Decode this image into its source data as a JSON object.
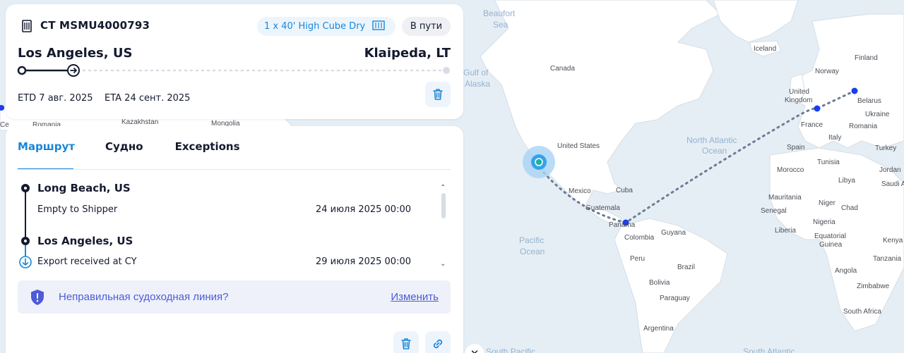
{
  "shipment": {
    "container_id": "CT MSMU4000793",
    "container_type": "1 x 40' High Cube Dry",
    "status": "В пути",
    "origin": "Los Angeles, US",
    "destination": "Klaipeda, LT",
    "etd": "ETD 7 авг. 2025",
    "eta": "ETA 24 сент. 2025",
    "progress": 0.12
  },
  "tabs": [
    "Маршрут",
    "Судно",
    "Exceptions"
  ],
  "route": [
    {
      "stop": "Long Beach, US",
      "event": "Empty to Shipper",
      "date": "24 июля 2025 00:00"
    },
    {
      "stop": "Los Angeles, US",
      "event": "Export received at CY",
      "date": "29 июля 2025 00:00"
    }
  ],
  "warning": {
    "text": "Неправильная судоходная линия?",
    "link": "Изменить"
  },
  "colors": {
    "accent": "#1a86d9",
    "dark": "#141a2e",
    "warning_text": "#4d5bd6",
    "map_land": "#ffffff",
    "map_water": "#e6eef5",
    "route_dots": "#6b7c93",
    "marker": "#1a3df0"
  },
  "map": {
    "labels": [
      "Beaufort",
      "Sea",
      "Gulf of",
      "Alaska",
      "Canada",
      "Iceland",
      "Finland",
      "Norway",
      "United",
      "Kingdom",
      "Belarus",
      "Ukraine",
      "France",
      "Romania",
      "Italy",
      "Spain",
      "Turkey",
      "Tunisia",
      "Morocco",
      "Jordan",
      "Libya",
      "Saudi A",
      "Mauritania",
      "Niger",
      "Chad",
      "Senegal",
      "Nigeria",
      "Liberia",
      "Equatorial",
      "Guinea",
      "Kenya",
      "Tanzania",
      "Angola",
      "Zimbabwe",
      "South Africa",
      "United States",
      "Mexico",
      "Cuba",
      "Guatemala",
      "Panama",
      "Guyana",
      "Colombia",
      "Peru",
      "Brazil",
      "Bolivia",
      "Paraguay",
      "Argentina",
      "Kazakhstan",
      "Mongolia",
      "Romania",
      "Ce"
    ],
    "oceans": [
      "North Atlantic",
      "Ocean",
      "Pacific",
      "Ocean",
      "South Pacific",
      "South Atlantic"
    ]
  }
}
